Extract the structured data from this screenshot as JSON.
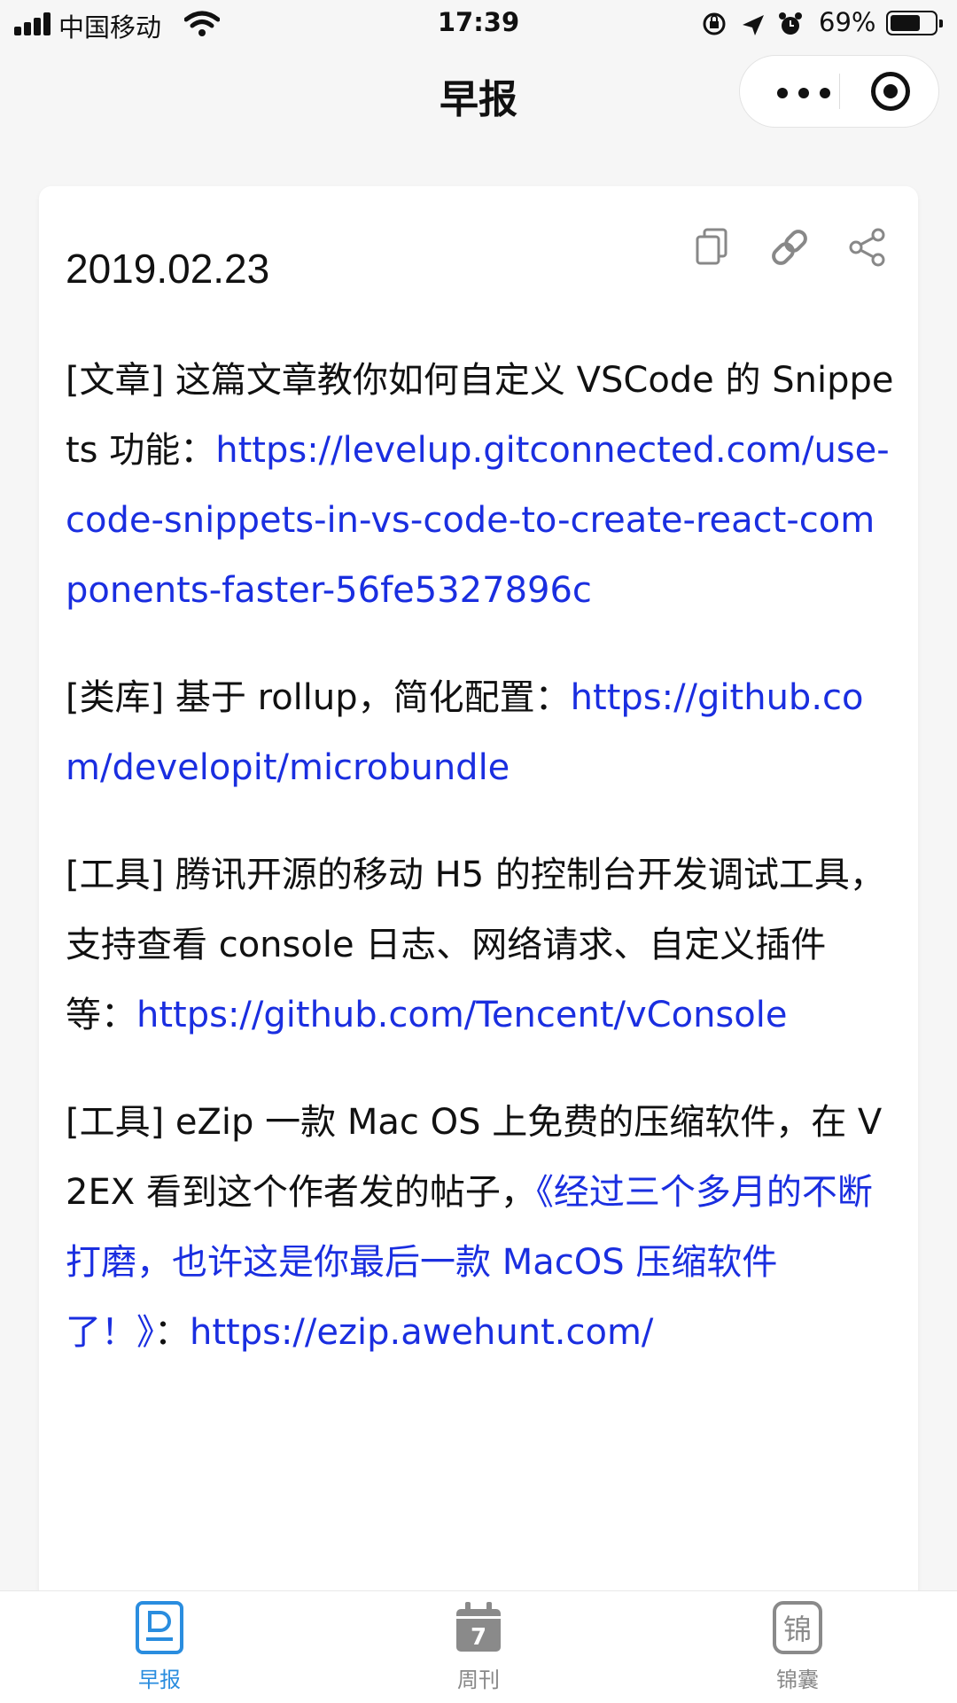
{
  "status_bar": {
    "carrier": "中国移动",
    "time": "17:39",
    "battery": "69%",
    "battery_level": 0.69
  },
  "nav": {
    "title": "早报"
  },
  "card": {
    "date": "2019.02.23",
    "entries": [
      {
        "text": "[文章] 这篇文章教你如何自定义 VSCode 的 Snippets 功能：",
        "link": "https://levelup.gitconnected.com/use-code-snippets-in-vs-code-to-create-react-components-faster-56fe5327896c"
      },
      {
        "text": "[类库] 基于 rollup，简化配置：",
        "link": "https://github.com/developit/microbundle"
      },
      {
        "text": "[工具] 腾讯开源的移动 H5 的控制台开发调试工具，支持查看 console 日志、网络请求、自定义插件等：",
        "link": "https://github.com/Tencent/vConsole"
      },
      {
        "text": "[工具] eZip 一款 Mac OS 上免费的压缩软件，在 V2EX 看到这个作者发的帖子，",
        "quote": "《经过三个多月的不断打磨，也许这是你最后一款 MacOS 压缩软件了！》",
        "sep": "：",
        "link": "https://ezip.awehunt.com/"
      }
    ]
  },
  "tabbar": {
    "tabs": [
      {
        "label": "早报",
        "active": true
      },
      {
        "label": "周刊",
        "active": false,
        "icon_text": "7"
      },
      {
        "label": "锦囊",
        "active": false,
        "icon_text": "锦"
      }
    ]
  },
  "colors": {
    "link": "#1a2ee0",
    "active_tab": "#2a8ddf",
    "inactive_tab": "#888888"
  }
}
